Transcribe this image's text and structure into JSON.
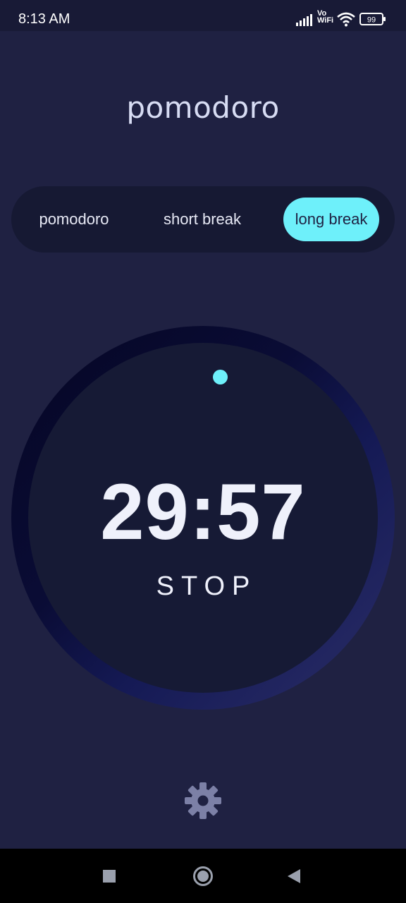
{
  "status_bar": {
    "time": "8:13 AM",
    "vo_label": "Vo",
    "wifi_label": "WiFi",
    "battery_level": "99",
    "icons": [
      "signal-icon",
      "vowifi-icon",
      "wifi-icon",
      "battery-icon"
    ]
  },
  "app": {
    "title": "pomodoro"
  },
  "modes": {
    "tabs": [
      {
        "label": "pomodoro",
        "selected": false
      },
      {
        "label": "short break",
        "selected": false
      },
      {
        "label": "long break",
        "selected": true
      }
    ]
  },
  "timer": {
    "time": "29:57",
    "action_label": "STOP"
  },
  "settings": {
    "icon": "gear-icon"
  },
  "nav_bar": {
    "icons": [
      "recent-apps-icon",
      "home-icon",
      "back-icon"
    ]
  },
  "colors": {
    "background": "#1f2142",
    "accent": "#6ef0fa",
    "panel": "#161933",
    "text": "#eff1fb"
  }
}
